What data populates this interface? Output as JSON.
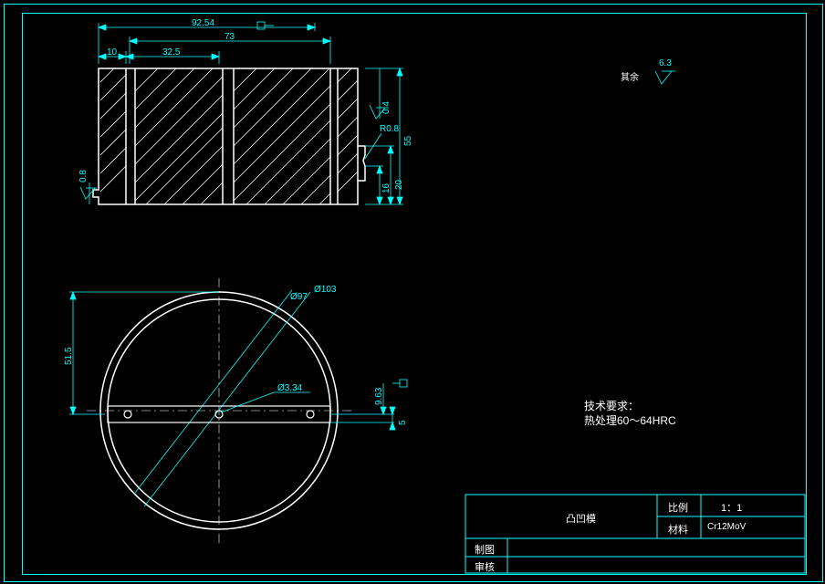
{
  "dims": {
    "top_total": "92.54",
    "top_73": "73",
    "top_10": "10",
    "top_325": "32.5",
    "right_55": "55",
    "right_20": "20",
    "right_16": "16",
    "right_r08": "R0.8",
    "surf_04": "0.4",
    "surf_08": "0.8",
    "surf_rest": "6.3",
    "rest_label": "其余"
  },
  "circle": {
    "d97": "Ø97",
    "d103": "Ø103",
    "d334": "Ø3.34",
    "v_515": "51.5",
    "h_963": "9.63",
    "h_5": "5"
  },
  "notes": {
    "req_title": "技术要求：",
    "req_line1": "热处理60～64HRC"
  },
  "titleblock": {
    "part_name": "凸凹模",
    "scale_label": "比例",
    "scale_val": "1：1",
    "mat_label": "材料",
    "mat_val": "Cr12MoV",
    "drawn": "制图",
    "check": "审核"
  }
}
